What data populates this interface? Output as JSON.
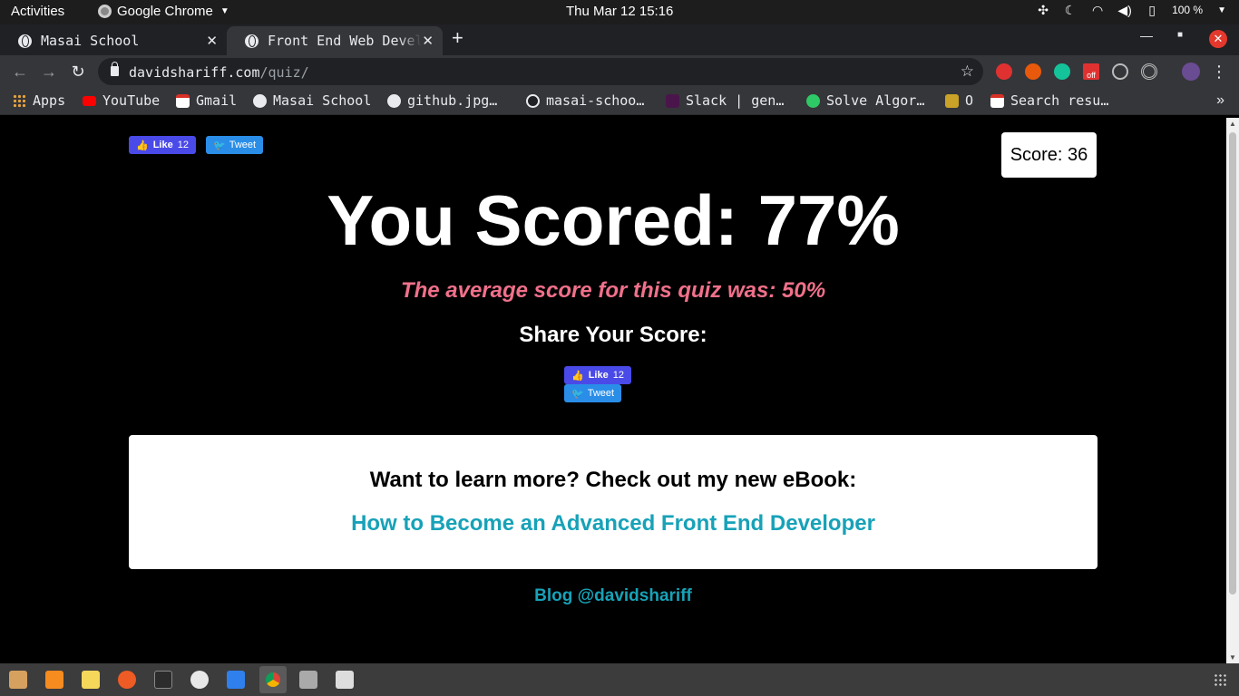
{
  "system_bar": {
    "activities": "Activities",
    "app_name": "Google Chrome",
    "clock": "Thu Mar 12  15:16",
    "battery": "100 %"
  },
  "tabs": [
    {
      "title": "Masai School",
      "active": false
    },
    {
      "title": "Front End Web Developer Quiz",
      "active": true
    }
  ],
  "toolbar": {
    "url_host": "davidshariff.com",
    "url_path": "/quiz/",
    "extension_badge": "off"
  },
  "bookmarks": [
    {
      "label": "Apps",
      "icon": "apps-grid-icon"
    },
    {
      "label": "YouTube",
      "icon": "youtube-icon"
    },
    {
      "label": "Gmail",
      "icon": "gmail-icon"
    },
    {
      "label": "Masai School",
      "icon": "globe-icon"
    },
    {
      "label": "github.jpg…",
      "icon": "globe-icon"
    },
    {
      "label": "masai-schoo…",
      "icon": "github-icon"
    },
    {
      "label": "Slack | gen…",
      "icon": "slack-icon"
    },
    {
      "label": "Solve Algor…",
      "icon": "hackerrank-icon"
    },
    {
      "label": "O",
      "icon": "bookmark-icon"
    },
    {
      "label": "Search resu…",
      "icon": "gmail-icon"
    }
  ],
  "page": {
    "like_label": "Like",
    "like_count": "12",
    "tweet_label": "Tweet",
    "score_label": "Score: 36",
    "headline": "You Scored: 77%",
    "average_text": "The average score for this quiz was: 50%",
    "share_title": "Share Your Score:",
    "ebook_pitch": "Want to learn more? Check out my new eBook:",
    "ebook_link": "How to Become an Advanced Front End Developer",
    "blog_link": "Blog @davidshariff"
  },
  "colors": {
    "average_text": "#f0708a",
    "link": "#17a2b8",
    "facebook": "#4a4ae8",
    "twitter": "#2a8ee8",
    "close_button": "#e4382d"
  }
}
